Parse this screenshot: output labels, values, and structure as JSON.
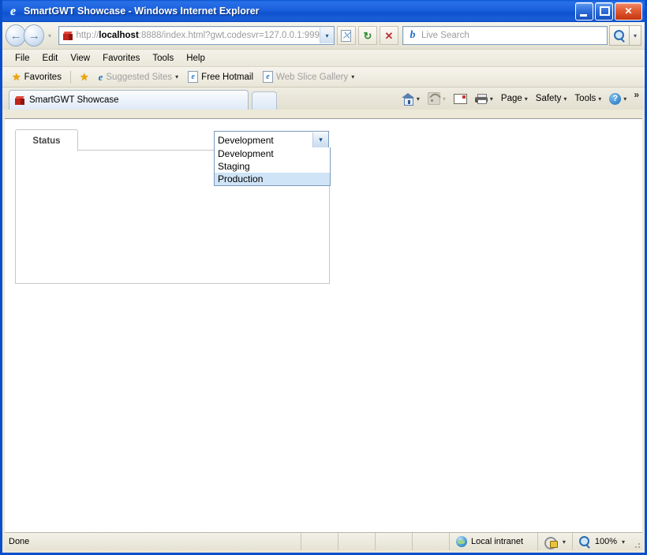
{
  "window": {
    "title": "SmartGWT Showcase - Windows Internet Explorer",
    "app_icon": "ie-logo-icon",
    "buttons": {
      "minimize": "minimize-button",
      "maximize": "maximize-button",
      "close": "close-button",
      "close_glyph": "✕"
    }
  },
  "navigation": {
    "back_glyph": "←",
    "forward_glyph": "→",
    "history_caret": "▾",
    "address": {
      "url_protocol": "http://",
      "url_host": "localhost",
      "url_rest": ":8888/index.html?gwt.codesvr=127.0.0.1:999",
      "full_url": "http://localhost:8888/index.html?gwt.codesvr=127.0.0.1:999",
      "dropdown_caret": "▾"
    },
    "compat_button": "compatibility-view-button",
    "refresh_button": "refresh-button",
    "stop_button": "stop-button",
    "stop_glyph": "✕",
    "refresh_glyph": "↻",
    "search": {
      "placeholder": "Live Search",
      "provider_glyph": "b",
      "go_glyph": "⌕",
      "dropdown_caret": "▾"
    }
  },
  "menubar": {
    "items": [
      {
        "label": "File"
      },
      {
        "label": "Edit"
      },
      {
        "label": "View"
      },
      {
        "label": "Favorites"
      },
      {
        "label": "Tools"
      },
      {
        "label": "Help"
      }
    ]
  },
  "favoritesbar": {
    "favorites_label": "Favorites",
    "items": [
      {
        "label": "Suggested Sites",
        "caret": "▾",
        "dim": true
      },
      {
        "label": "Free Hotmail",
        "caret": "",
        "dim": false
      },
      {
        "label": "Web Slice Gallery",
        "caret": "▾",
        "dim": true
      }
    ]
  },
  "tabbar": {
    "tabs": [
      {
        "label": "SmartGWT Showcase",
        "icon": "smartgwt-cube-icon"
      }
    ],
    "new_tab_label": "",
    "commands": [
      {
        "label": "",
        "icon": "home-icon",
        "caret": "▾"
      },
      {
        "label": "",
        "icon": "rss-feed-icon",
        "caret": "▾"
      },
      {
        "label": "",
        "icon": "read-mail-icon",
        "caret": ""
      },
      {
        "label": "",
        "icon": "print-icon",
        "caret": "▾"
      },
      {
        "label": "Page",
        "icon": "",
        "caret": "▾"
      },
      {
        "label": "Safety",
        "icon": "",
        "caret": "▾"
      },
      {
        "label": "Tools",
        "icon": "",
        "caret": "▾"
      },
      {
        "label": "",
        "icon": "help-icon",
        "caret": "▾"
      }
    ],
    "overflow_glyph": "»"
  },
  "page": {
    "tab": {
      "label": "Status"
    },
    "select": {
      "name": "environment-select",
      "value": "Development",
      "arrow_glyph": "▾",
      "expanded": true,
      "options": [
        {
          "label": "Development",
          "selected": false
        },
        {
          "label": "Staging",
          "selected": false
        },
        {
          "label": "Production",
          "selected": true
        }
      ]
    }
  },
  "statusbar": {
    "message": "Done",
    "zone": "Local intranet",
    "zone_icon": "internet-zone-globe-icon",
    "protected_mode_icon": "protected-mode-icon",
    "protected_caret": "▾",
    "zoom_level": "100%",
    "zoom_icon": "zoom-magnifier-icon",
    "zoom_caret": "▾"
  },
  "colors": {
    "titlebar_blue": "#1d63de",
    "window_border": "#0a4ecb",
    "chrome_beige": "#ece9d8",
    "select_highlight": "#cfe4f7",
    "panel_border": "#c6c6c6"
  }
}
